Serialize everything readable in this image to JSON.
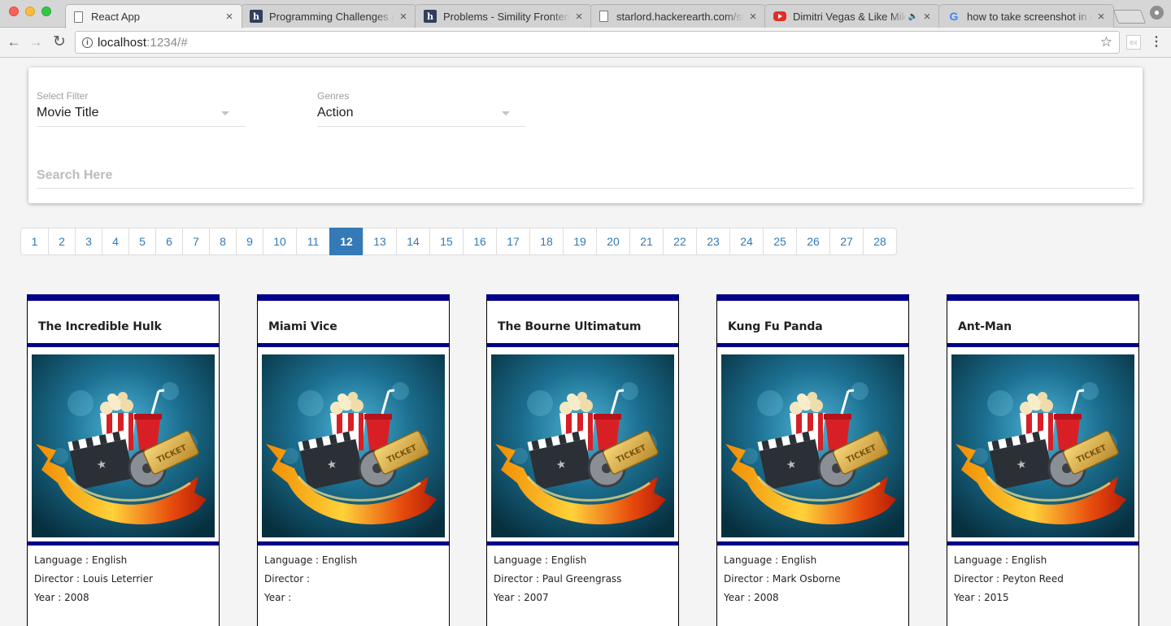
{
  "browser": {
    "tabs": [
      {
        "label": "React App",
        "favicon": "document-icon",
        "active": true
      },
      {
        "label": "Programming Challenges & I",
        "favicon": "hackerearth-icon"
      },
      {
        "label": "Problems - Simility Frontend",
        "favicon": "hackerearth-icon"
      },
      {
        "label": "starlord.hackerearth.com/si",
        "favicon": "document-icon"
      },
      {
        "label": "Dimitri Vegas & Like Mike",
        "favicon": "youtube-icon",
        "audio": true
      },
      {
        "label": "how to take screenshot in m",
        "favicon": "google-icon"
      }
    ],
    "url_host": "localhost",
    "url_rest": ":1234/#"
  },
  "filters": {
    "select_filter": {
      "label": "Select Filter",
      "value": "Movie Title"
    },
    "genres": {
      "label": "Genres",
      "value": "Action"
    },
    "search_placeholder": "Search Here"
  },
  "pagination": {
    "pages": [
      "1",
      "2",
      "3",
      "4",
      "5",
      "6",
      "7",
      "8",
      "9",
      "10",
      "11",
      "12",
      "13",
      "14",
      "15",
      "16",
      "17",
      "18",
      "19",
      "20",
      "21",
      "22",
      "23",
      "24",
      "25",
      "26",
      "27",
      "28"
    ],
    "active": "12"
  },
  "movies": [
    {
      "title": "The Incredible Hulk",
      "language": "Language : English",
      "director": "Director : Louis Leterrier",
      "year": "Year : 2008"
    },
    {
      "title": "Miami Vice",
      "language": "Language : English",
      "director": "Director :",
      "year": "Year :"
    },
    {
      "title": "The Bourne Ultimatum",
      "language": "Language : English",
      "director": "Director : Paul Greengrass",
      "year": "Year : 2007"
    },
    {
      "title": "Kung Fu Panda",
      "language": "Language : English",
      "director": "Director : Mark Osborne",
      "year": "Year : 2008"
    },
    {
      "title": "Ant-Man",
      "language": "Language : English",
      "director": "Director : Peyton Reed",
      "year": "Year : 2015"
    }
  ],
  "colors": {
    "card_accent": "#00008b",
    "page_active": "#337ab7",
    "page_link": "#337ab7"
  }
}
